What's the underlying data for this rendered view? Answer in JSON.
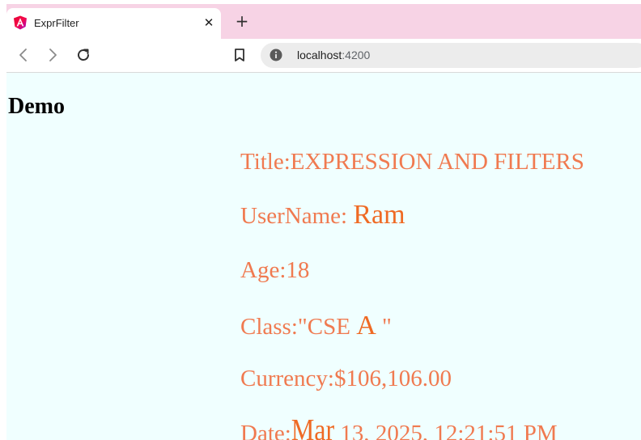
{
  "browser": {
    "tab": {
      "title": "ExprFilter",
      "favicon": "angular-logo-icon",
      "close_glyph": "✕"
    },
    "new_tab_glyph": "+",
    "toolbar": {
      "back_icon": "back-arrow-icon",
      "forward_icon": "forward-arrow-icon",
      "reload_icon": "reload-icon",
      "bookmark_icon": "bookmark-icon",
      "site_info_icon": "site-info-icon"
    },
    "address_bar": {
      "host": "localhost",
      "port": ":4200"
    }
  },
  "page": {
    "heading": "Demo",
    "lines": {
      "title": {
        "label": "Title:",
        "value": "EXPRESSION AND FILTERS"
      },
      "username": {
        "label": "UserName:",
        "value": "Ram"
      },
      "age": {
        "label": "Age:",
        "value": "18"
      },
      "class": {
        "label": "Class:\"CSE",
        "value": "A",
        "suffix": "\""
      },
      "currency": {
        "label": "Currency:",
        "value": "$106,106.00"
      },
      "date": {
        "label": "Date:",
        "month": "Mar",
        "rest": "13, 2025, 12:21:51 PM"
      }
    }
  },
  "colors": {
    "tabstrip": "#f7d3e5",
    "page_background": "#f0ffff",
    "text_accent": "#f07a50",
    "emphasis": "#ef6a24"
  }
}
